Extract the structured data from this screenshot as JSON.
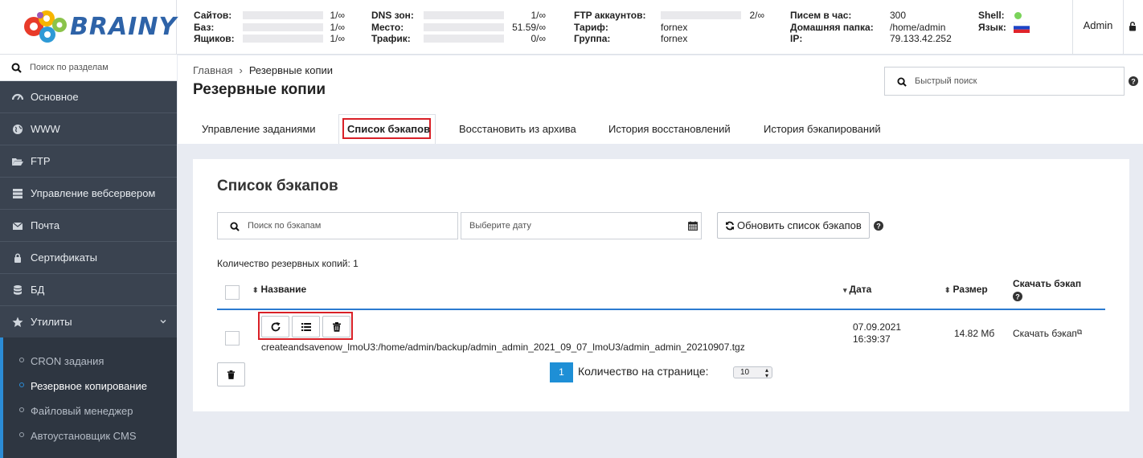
{
  "brand": {
    "name": "BRAINY"
  },
  "header": {
    "stats_col1": [
      {
        "label": "Сайтов:",
        "value": "1/∞"
      },
      {
        "label": "Баз:",
        "value": "1/∞"
      },
      {
        "label": "Ящиков:",
        "value": "1/∞"
      }
    ],
    "stats_col2": [
      {
        "label": "DNS зон:",
        "value": "1/∞"
      },
      {
        "label": "Место:",
        "value": "51.59/∞"
      },
      {
        "label": "Трафик:",
        "value": "0/∞"
      }
    ],
    "stats_col3": [
      {
        "label": "FTP аккаунтов:",
        "value": "2/∞"
      },
      {
        "label": "Тариф:",
        "value": "fornex"
      },
      {
        "label": "Группа:",
        "value": "fornex"
      }
    ],
    "stats_col4": [
      {
        "label": "Писем в час:",
        "value": "300"
      },
      {
        "label": "Домашняя папка:",
        "value": "/home/admin"
      },
      {
        "label": "IP:",
        "value": "79.133.42.252"
      }
    ],
    "shell_label": "Shell:",
    "lang_label": "Язык:",
    "user": "Admin",
    "shell_status_color": "#7ad35a"
  },
  "sidebar": {
    "search_placeholder": "Поиск по разделам",
    "items": [
      {
        "label": "Основное",
        "icon": "dashboard-icon"
      },
      {
        "label": "WWW",
        "icon": "globe-icon"
      },
      {
        "label": "FTP",
        "icon": "folder-open-icon"
      },
      {
        "label": "Управление вебсервером",
        "icon": "server-icon"
      },
      {
        "label": "Почта",
        "icon": "envelope-icon"
      },
      {
        "label": "Сертификаты",
        "icon": "lock-icon"
      },
      {
        "label": "БД",
        "icon": "database-icon"
      },
      {
        "label": "Утилиты",
        "icon": "star-icon"
      }
    ],
    "subitems": [
      {
        "label": "CRON задания"
      },
      {
        "label": "Резервное копирование",
        "active": true
      },
      {
        "label": "Файловый менеджер"
      },
      {
        "label": "Автоустановщик CMS"
      }
    ]
  },
  "breadcrumb": {
    "home": "Главная",
    "current": "Резервные копии"
  },
  "page": {
    "title": "Резервные копии",
    "quick_search_placeholder": "Быстрый поиск"
  },
  "tabs": [
    {
      "label": "Управление заданиями"
    },
    {
      "label": "Список бэкапов",
      "active": true
    },
    {
      "label": "Восстановить из архива"
    },
    {
      "label": "История восстановлений"
    },
    {
      "label": "История бэкапирований"
    }
  ],
  "backups": {
    "title": "Список бэкапов",
    "search_placeholder": "Поиск по бэкапам",
    "date_placeholder": "Выберите дату",
    "refresh_label": "Обновить список бэкапов",
    "count_text": "Количество резервных копий: 1",
    "columns": {
      "name": "Название",
      "date": "Дата",
      "size": "Размер",
      "download": "Скачать бэкап"
    },
    "rows": [
      {
        "name": "createandsavenow_lmoU3:/home/admin/backup/admin_admin_2021_09_07_lmoU3/admin_admin_20210907.tgz",
        "date": "07.09.2021",
        "time": "16:39:37",
        "size": "14.82 Мб",
        "download": "Скачать бэкап"
      }
    ],
    "pagination": {
      "current_page": "1",
      "per_page_label": "Количество на странице:",
      "per_page_value": "10"
    }
  },
  "colors": {
    "accent": "#1e8fd6",
    "highlight": "#d92027",
    "sidebar_bg": "#3a4350",
    "page_bg": "#e8ebf2"
  }
}
